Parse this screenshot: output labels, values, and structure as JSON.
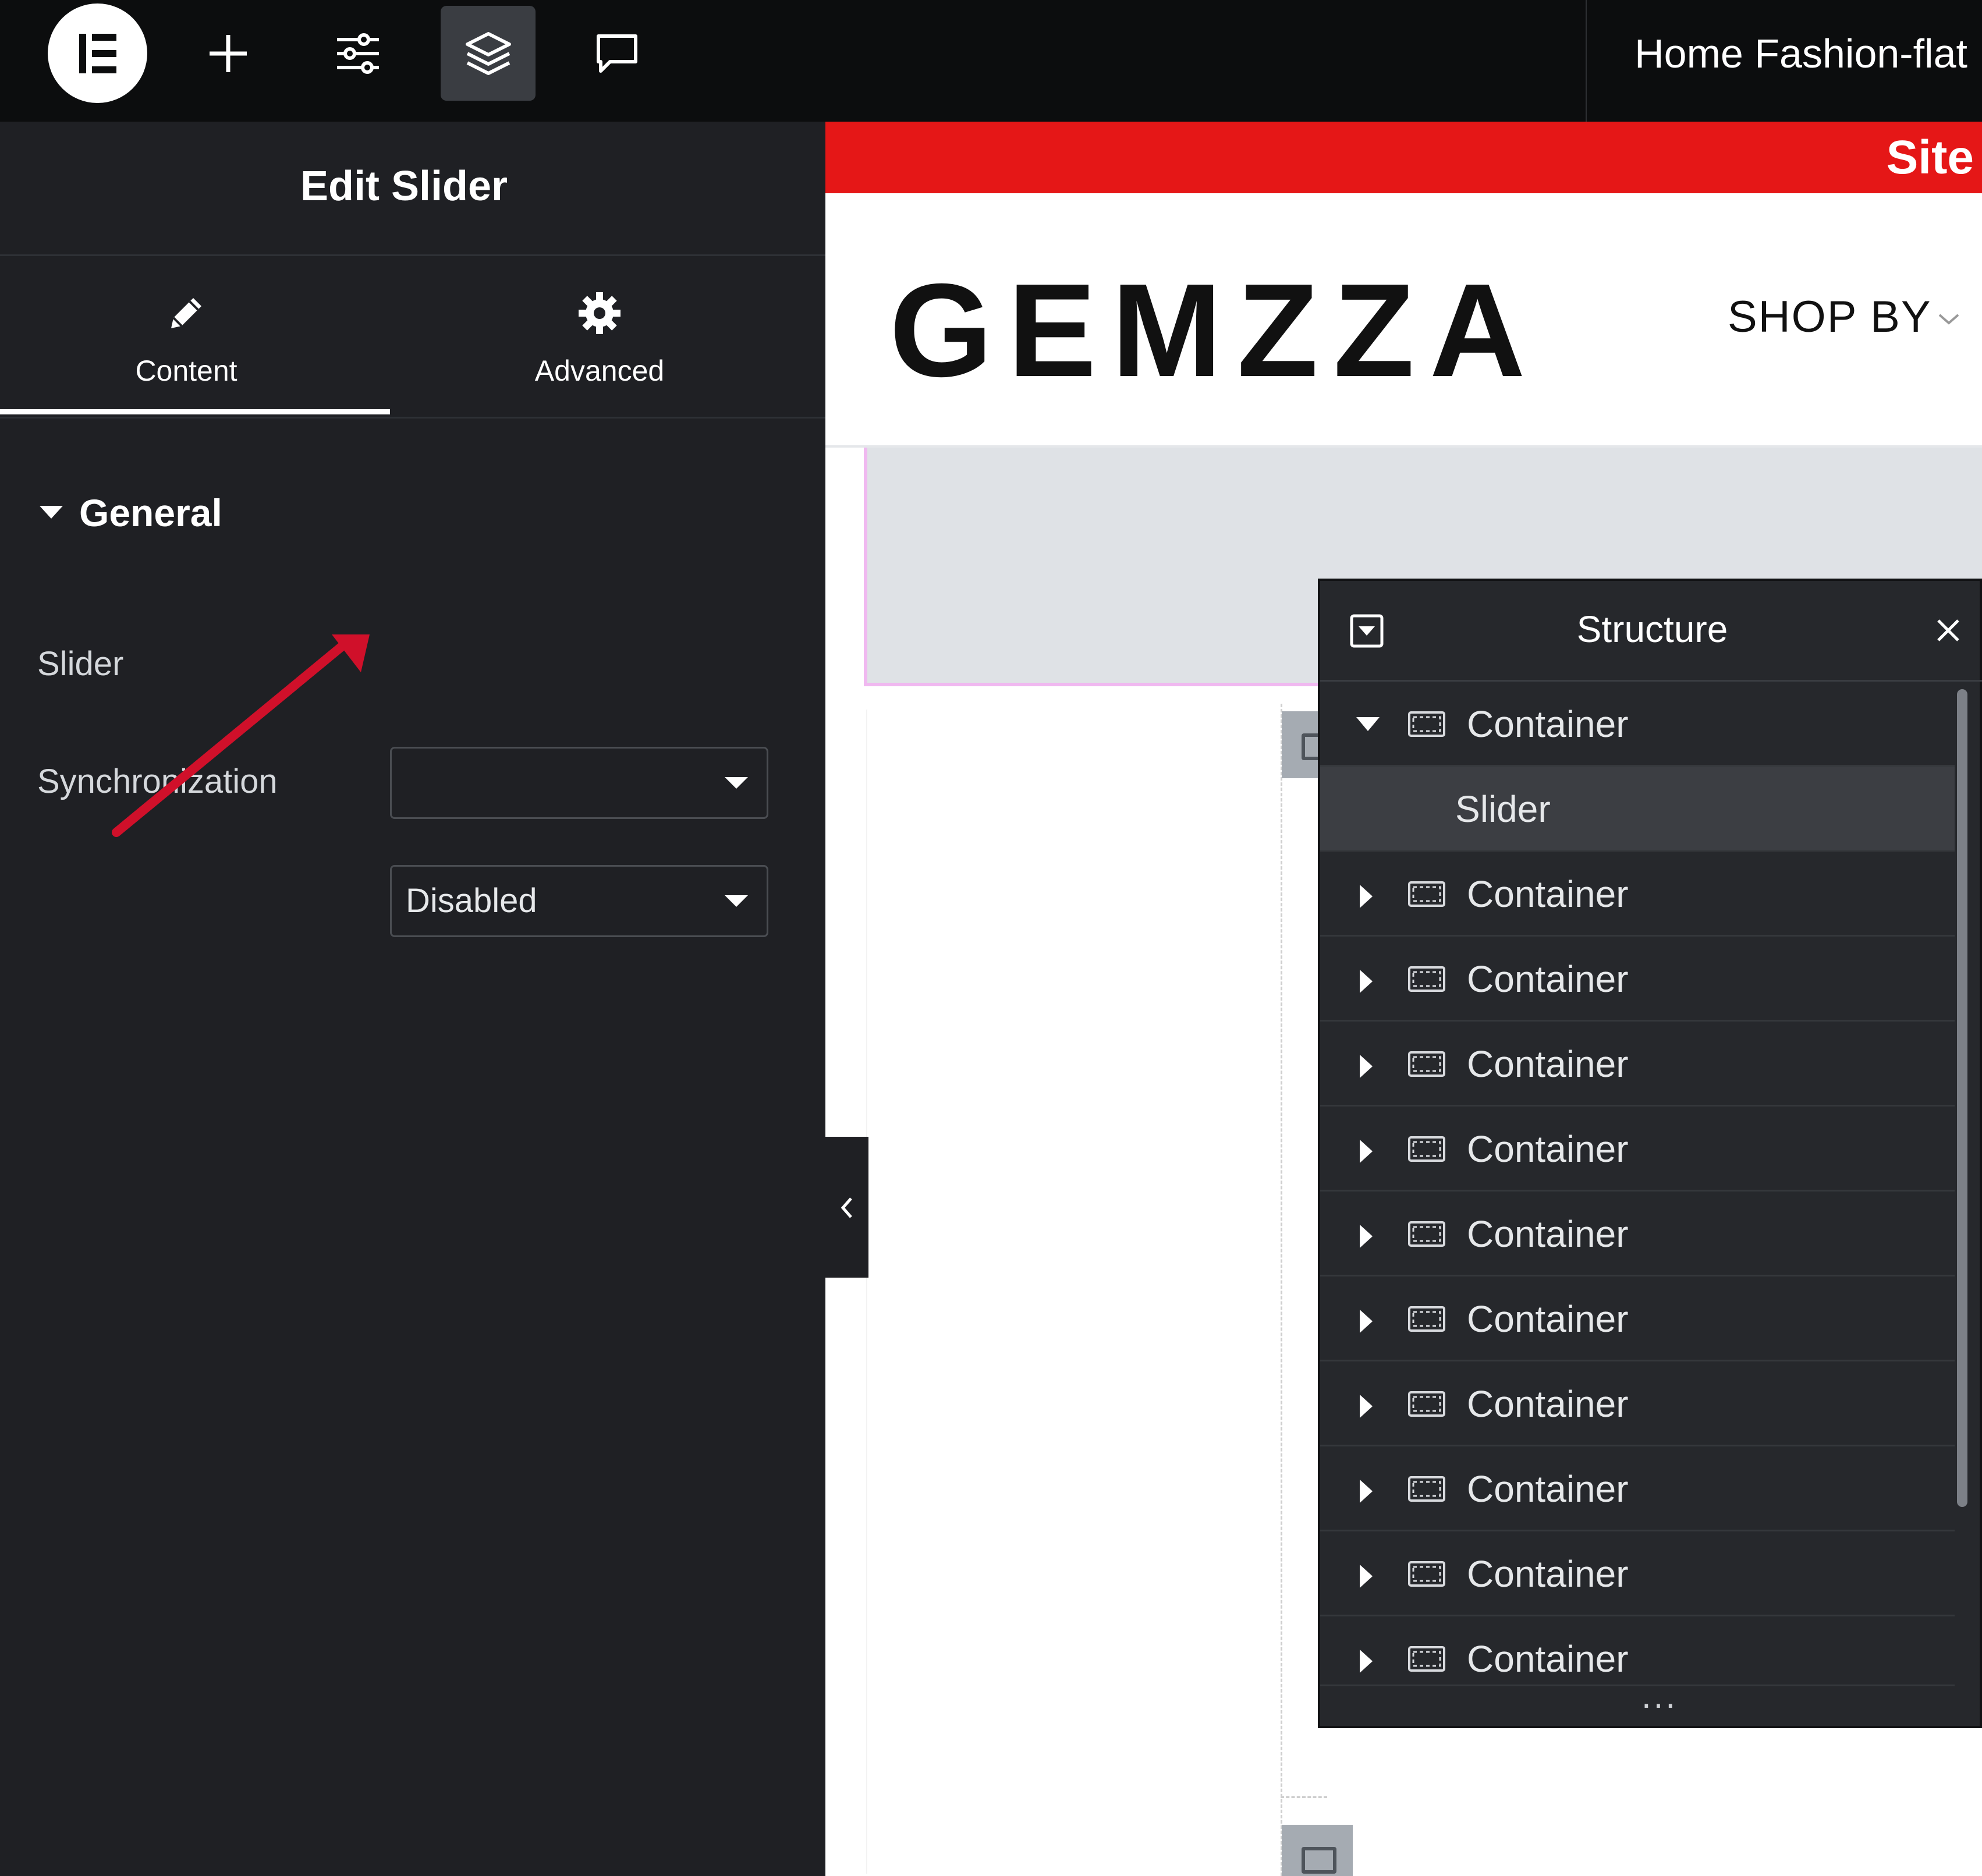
{
  "topbar": {
    "document_title": "Home Fashion-flat",
    "icons": [
      "elementor-logo-icon",
      "plus-icon",
      "sliders-icon",
      "layers-icon",
      "comment-icon"
    ]
  },
  "panel": {
    "title": "Edit Slider",
    "tabs": [
      {
        "label": "Content",
        "icon": "pencil-icon",
        "active": true
      },
      {
        "label": "Advanced",
        "icon": "gear-icon",
        "active": false
      }
    ],
    "section": {
      "title": "General",
      "expanded": true
    },
    "fields": [
      {
        "label": "Slider",
        "value": ""
      },
      {
        "label": "Synchronization",
        "value": "Disabled"
      }
    ]
  },
  "canvas": {
    "banner_text": "Site",
    "logo_text": "GEMZZA",
    "nav_item": "SHOP BY"
  },
  "structure": {
    "title": "Structure",
    "items": [
      {
        "label": "Container",
        "expanded": true,
        "level": 0
      },
      {
        "label": "Slider",
        "selected": true,
        "level": 1
      },
      {
        "label": "Container",
        "level": 0
      },
      {
        "label": "Container",
        "level": 0
      },
      {
        "label": "Container",
        "level": 0
      },
      {
        "label": "Container",
        "level": 0
      },
      {
        "label": "Container",
        "level": 0
      },
      {
        "label": "Container",
        "level": 0
      },
      {
        "label": "Container",
        "level": 0
      },
      {
        "label": "Container",
        "level": 0
      },
      {
        "label": "Container",
        "level": 0
      },
      {
        "label": "Container",
        "level": 0
      }
    ],
    "more": "..."
  },
  "colors": {
    "topbar": "#0c0d0e",
    "panel": "#1f2024",
    "banner": "#e51717",
    "annotation_arrow": "#d0102a",
    "structure_bg": "#26282c"
  }
}
